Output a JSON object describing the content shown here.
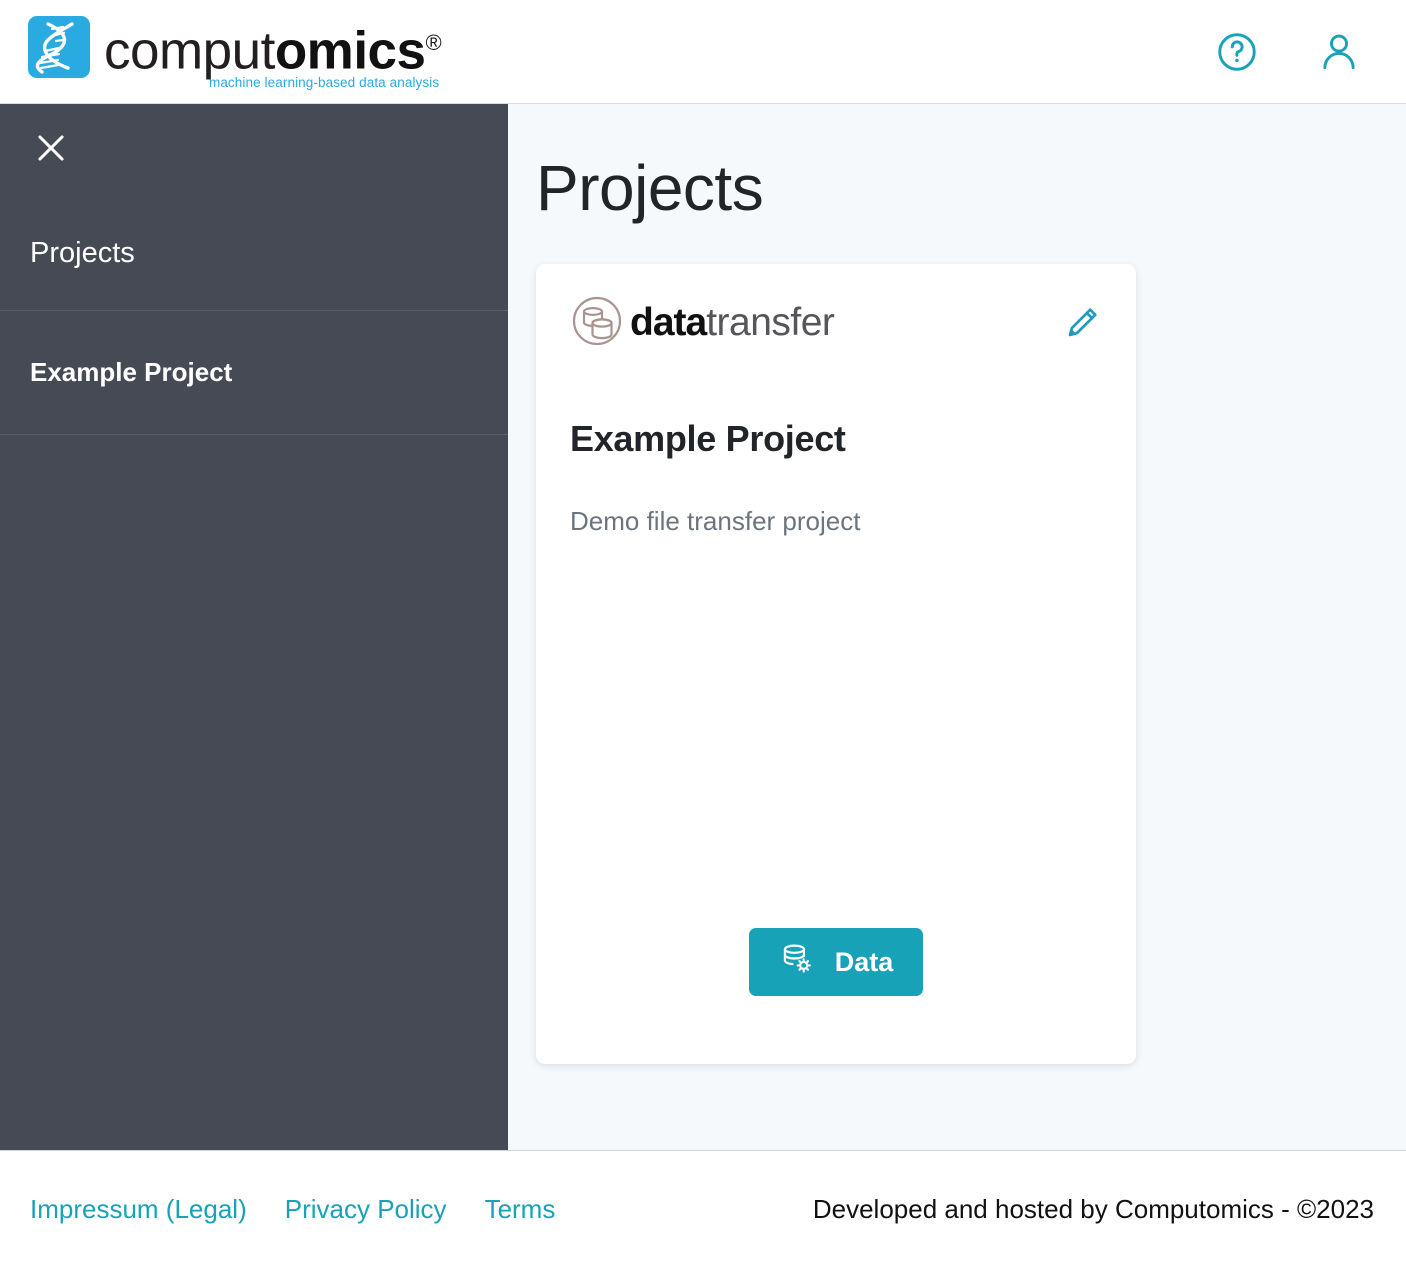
{
  "brand": {
    "name_thin": "comput",
    "name_strong": "omics",
    "registered": "®",
    "tagline": "machine learning-based data analysis",
    "logo_icon": "dna-helix-icon",
    "blue": "#29abe2"
  },
  "header": {
    "help_icon": "help-circle-icon",
    "account_icon": "user-account-icon",
    "accent": "#17a2b8"
  },
  "sidebar": {
    "close_icon": "close-icon",
    "background": "#454a54",
    "items": [
      {
        "label": "Projects",
        "bold": false
      },
      {
        "label": "Example Project",
        "bold": true
      }
    ]
  },
  "main": {
    "title": "Projects",
    "background": "#f5f9fc"
  },
  "card": {
    "logo": {
      "icon": "database-circle-icon",
      "icon_color": "#a89490",
      "word_bold": "data",
      "word_light": "transfer"
    },
    "edit_icon": "pencil-edit-icon",
    "title": "Example Project",
    "description": "Demo file transfer project",
    "action": {
      "icon": "database-gear-icon",
      "label": "Data",
      "color": "#17a2b8"
    }
  },
  "footer": {
    "links": [
      {
        "label": "Impressum (Legal)"
      },
      {
        "label": "Privacy Policy"
      },
      {
        "label": "Terms"
      }
    ],
    "credit": "Developed and hosted by Computomics - ©2023",
    "link_color": "#17a2b8"
  }
}
